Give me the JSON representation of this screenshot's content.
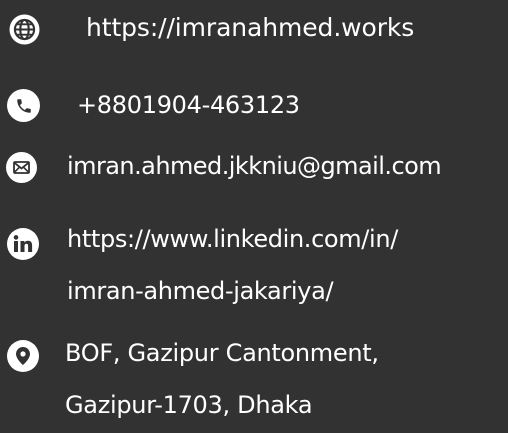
{
  "contact": {
    "website": {
      "icon": "globe-icon",
      "text": "https://imranahmed.works"
    },
    "phone": {
      "icon": "phone-icon",
      "text": "+8801904-463123"
    },
    "email": {
      "icon": "envelope-icon",
      "text": "imran.ahmed.jkkniu@gmail.com"
    },
    "linkedin": {
      "icon": "linkedin-icon",
      "line1": "https://www.linkedin.com/in/",
      "line2": "imran-ahmed-jakariya/"
    },
    "address": {
      "icon": "location-pin-icon",
      "line1": "BOF, Gazipur Cantonment,",
      "line2": "Gazipur-1703, Dhaka"
    }
  },
  "colors": {
    "background": "#323232",
    "foreground": "#ffffff"
  }
}
